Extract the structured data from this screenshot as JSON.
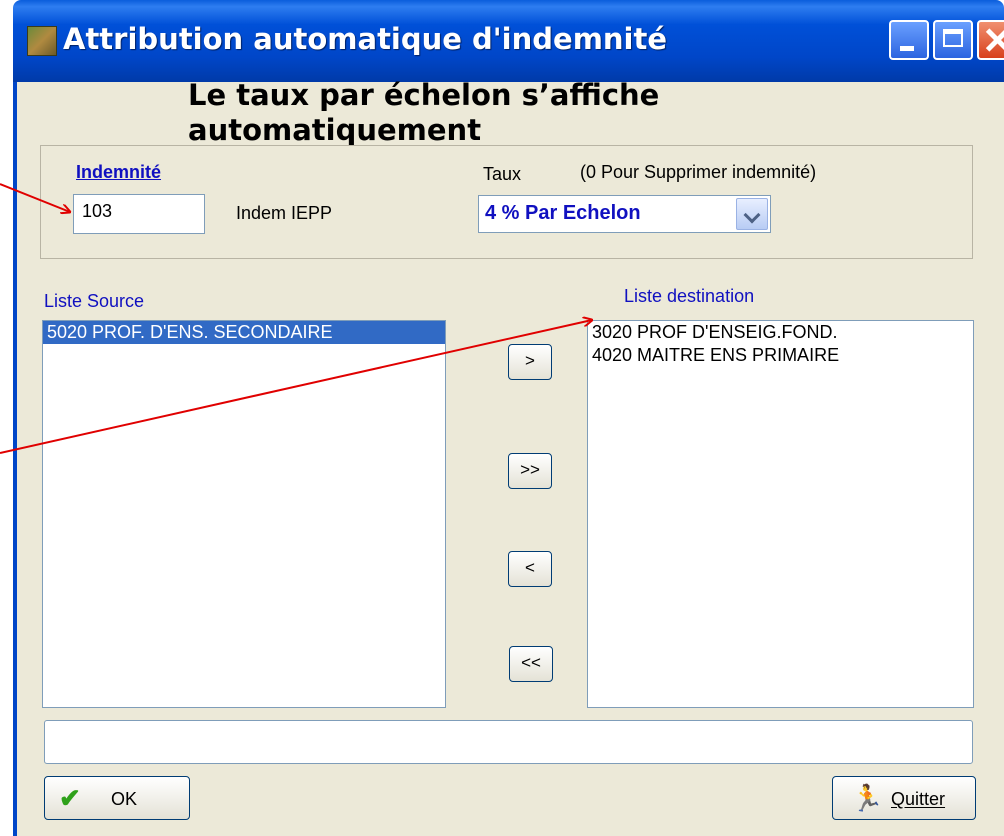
{
  "window": {
    "title": "Attribution automatique d'indemnité"
  },
  "annotation": {
    "heading": "Le taux par échelon s’affiche automatiquement",
    "arrow_color": "#e00000"
  },
  "indemnite": {
    "label": "Indemnité",
    "code": "103",
    "name": "Indem IEPP"
  },
  "taux": {
    "label": "Taux",
    "note": "(0 Pour Supprimer indemnité)",
    "selected": "4 %  Par Echelon"
  },
  "source": {
    "label": "Liste Source",
    "items": [
      "5020 PROF. D'ENS. SECONDAIRE"
    ]
  },
  "destination": {
    "label": "Liste destination",
    "items": [
      "3020 PROF D'ENSEIG.FOND.",
      "4020 MAITRE ENS PRIMAIRE"
    ]
  },
  "move_buttons": {
    "add_one": ">",
    "add_all": ">>",
    "remove_one": "<",
    "remove_all": "<<"
  },
  "status": "",
  "buttons": {
    "ok": "OK",
    "quit": "Quitter"
  },
  "colors": {
    "title_bar": "#0050d8",
    "link_blue": "#1010c0",
    "selection": "#316ac5",
    "dialog_bg": "#ece9d8"
  }
}
